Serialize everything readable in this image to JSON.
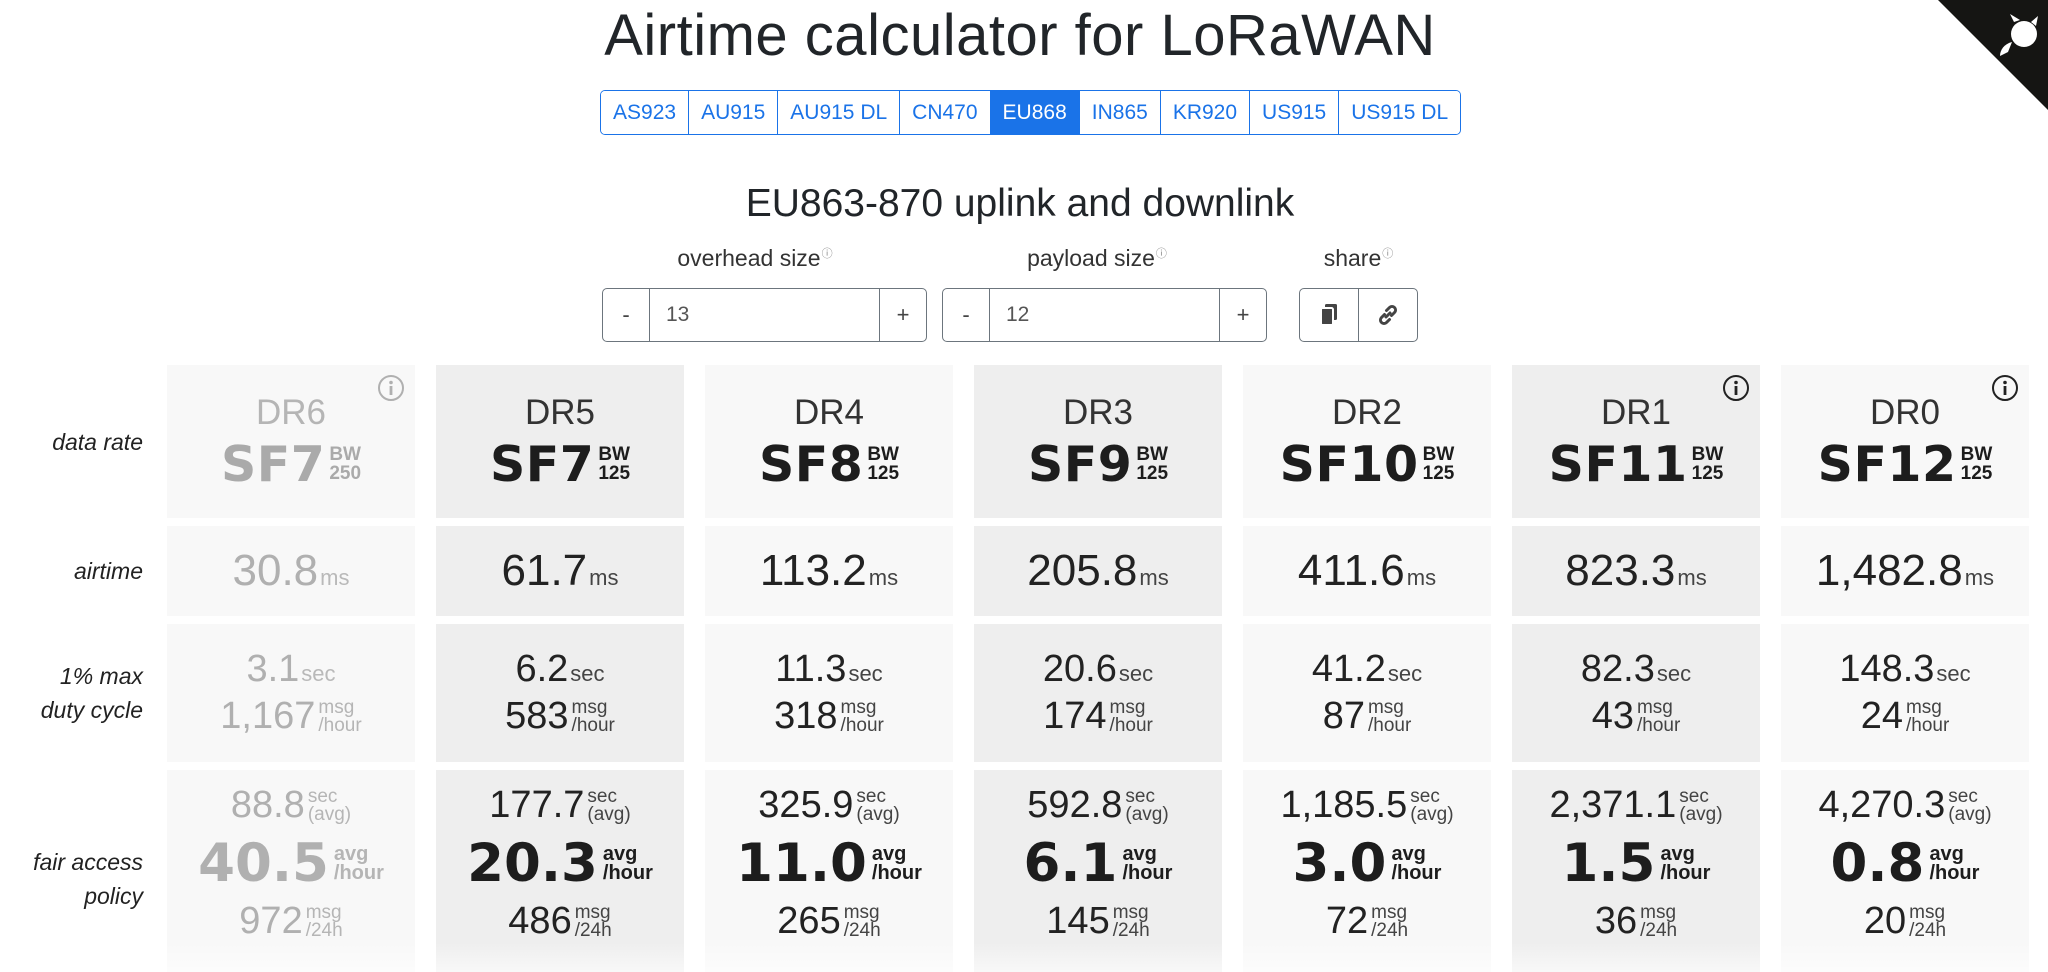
{
  "title": "Airtime calculator for LoRaWAN",
  "regions": [
    "AS923",
    "AU915",
    "AU915 DL",
    "CN470",
    "EU868",
    "IN865",
    "KR920",
    "US915",
    "US915 DL"
  ],
  "active_region": "EU868",
  "subtitle": "EU863-870 uplink and downlink",
  "controls": {
    "overhead": {
      "label": "overhead size",
      "info": "ⓘ",
      "value": "13",
      "minus": "-",
      "plus": "+"
    },
    "payload": {
      "label": "payload size",
      "info": "ⓘ",
      "value": "12",
      "minus": "-",
      "plus": "+"
    },
    "share": {
      "label": "share",
      "info": "ⓘ",
      "copy_icon": "copy-icon",
      "link_icon": "link-icon"
    }
  },
  "row_labels": {
    "data_rate": "data rate",
    "airtime": "airtime",
    "duty_cycle": [
      "1% max",
      "duty cycle"
    ],
    "fair_access": [
      "fair access",
      "policy"
    ]
  },
  "units": {
    "ms": "ms",
    "sec": "sec",
    "msg": "msg",
    "hour": "/hour",
    "avg_paren": "(avg)",
    "avg": "avg",
    "per_24h": "/24h"
  },
  "columns": [
    {
      "dr": "DR6",
      "sf": "SF7",
      "bw": "250",
      "bw_label": "BW",
      "airtime": "30.8",
      "duty_sec": "3.1",
      "duty_msg": "1,167",
      "fair_sec": "88.8",
      "fair_avg": "40.5",
      "fair_msg": "972",
      "dimmed": true,
      "info": true
    },
    {
      "dr": "DR5",
      "sf": "SF7",
      "bw": "125",
      "bw_label": "BW",
      "airtime": "61.7",
      "duty_sec": "6.2",
      "duty_msg": "583",
      "fair_sec": "177.7",
      "fair_avg": "20.3",
      "fair_msg": "486",
      "dimmed": false,
      "info": false
    },
    {
      "dr": "DR4",
      "sf": "SF8",
      "bw": "125",
      "bw_label": "BW",
      "airtime": "113.2",
      "duty_sec": "11.3",
      "duty_msg": "318",
      "fair_sec": "325.9",
      "fair_avg": "11.0",
      "fair_msg": "265",
      "dimmed": false,
      "info": false
    },
    {
      "dr": "DR3",
      "sf": "SF9",
      "bw": "125",
      "bw_label": "BW",
      "airtime": "205.8",
      "duty_sec": "20.6",
      "duty_msg": "174",
      "fair_sec": "592.8",
      "fair_avg": "6.1",
      "fair_msg": "145",
      "dimmed": false,
      "info": false
    },
    {
      "dr": "DR2",
      "sf": "SF10",
      "bw": "125",
      "bw_label": "BW",
      "airtime": "411.6",
      "duty_sec": "41.2",
      "duty_msg": "87",
      "fair_sec": "1,185.5",
      "fair_avg": "3.0",
      "fair_msg": "72",
      "dimmed": false,
      "info": false
    },
    {
      "dr": "DR1",
      "sf": "SF11",
      "bw": "125",
      "bw_label": "BW",
      "airtime": "823.3",
      "duty_sec": "82.3",
      "duty_msg": "43",
      "fair_sec": "2,371.1",
      "fair_avg": "1.5",
      "fair_msg": "36",
      "dimmed": false,
      "info": true
    },
    {
      "dr": "DR0",
      "sf": "SF12",
      "bw": "125",
      "bw_label": "BW",
      "airtime": "1,482.8",
      "duty_sec": "148.3",
      "duty_msg": "24",
      "fair_sec": "4,270.3",
      "fair_avg": "0.8",
      "fair_msg": "20",
      "dimmed": false,
      "info": true
    }
  ],
  "colors": {
    "accent": "#1a73e8",
    "cell_light": "#f8f8f8",
    "cell_dark": "#eeeeee"
  },
  "corner_icon": "github-octocat-icon"
}
